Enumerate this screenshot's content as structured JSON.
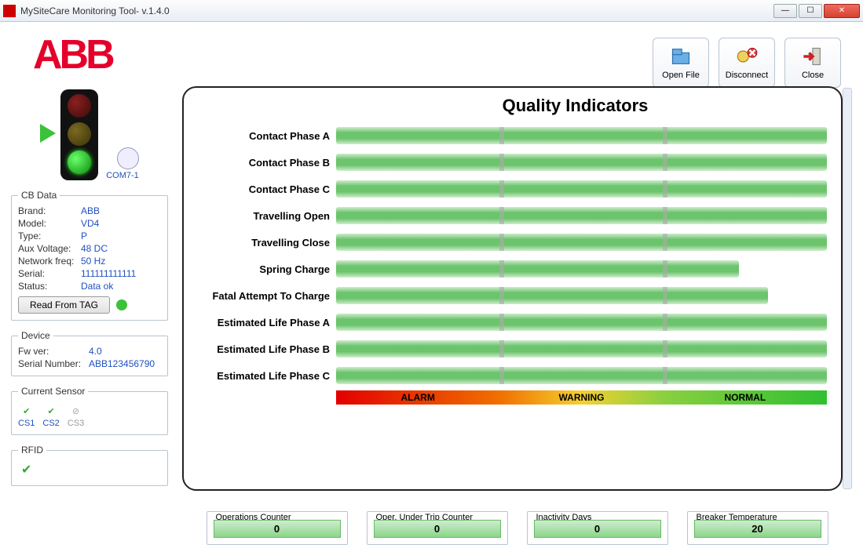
{
  "window": {
    "title": "MySiteCare Monitoring Tool- v.1.4.0"
  },
  "toolbar": {
    "open_file": "Open File",
    "disconnect": "Disconnect",
    "close": "Close"
  },
  "connection": {
    "com_label": "COM7-1"
  },
  "cb_data": {
    "legend": "CB Data",
    "fields": {
      "brand_k": "Brand:",
      "brand_v": "ABB",
      "model_k": "Model:",
      "model_v": "VD4",
      "type_k": "Type:",
      "type_v": "P",
      "aux_k": "Aux Voltage:",
      "aux_v": "48   DC",
      "freq_k": "Network freq:",
      "freq_v": "50 Hz",
      "serial_k": "Serial:",
      "serial_v": "111111111111",
      "status_k": "Status:",
      "status_v": "Data ok"
    },
    "read_tag": "Read From TAG"
  },
  "device": {
    "legend": "Device",
    "fw_k": "Fw ver:",
    "fw_v": "4.0",
    "sn_k": "Serial Number:",
    "sn_v": "ABB123456790"
  },
  "sensors": {
    "legend": "Current Sensor",
    "cs1": "CS1",
    "cs2": "CS2",
    "cs3": "CS3"
  },
  "rfid": {
    "legend": "RFID"
  },
  "panel": {
    "title": "Quality Indicators",
    "indicators": [
      {
        "label": "Contact Phase A",
        "pct": 100
      },
      {
        "label": "Contact Phase B",
        "pct": 100
      },
      {
        "label": "Contact Phase C",
        "pct": 100
      },
      {
        "label": "Travelling Open",
        "pct": 100
      },
      {
        "label": "Travelling Close",
        "pct": 100
      },
      {
        "label": "Spring Charge",
        "pct": 82
      },
      {
        "label": "Fatal Attempt To Charge",
        "pct": 88
      },
      {
        "label": "Estimated Life Phase A",
        "pct": 100
      },
      {
        "label": "Estimated Life Phase B",
        "pct": 100
      },
      {
        "label": "Estimated Life Phase C",
        "pct": 100
      }
    ],
    "zones": {
      "alarm": "ALARM",
      "warning": "WARNING",
      "normal": "NORMAL"
    }
  },
  "counters": {
    "ops": {
      "label": "Operations Counter",
      "value": "0"
    },
    "trip": {
      "label": "Oper. Under Trip Counter",
      "value": "0"
    },
    "inact": {
      "label": "Inactivity Days",
      "value": "0"
    },
    "temp": {
      "label": "Breaker Temperature",
      "value": "20"
    }
  },
  "chart_data": {
    "type": "bar",
    "title": "Quality Indicators",
    "categories": [
      "Contact Phase A",
      "Contact Phase B",
      "Contact Phase C",
      "Travelling Open",
      "Travelling Close",
      "Spring Charge",
      "Fatal Attempt To Charge",
      "Estimated Life Phase A",
      "Estimated Life Phase B",
      "Estimated Life Phase C"
    ],
    "values": [
      100,
      100,
      100,
      100,
      100,
      82,
      88,
      100,
      100,
      100
    ],
    "zones": [
      {
        "name": "ALARM",
        "range": [
          0,
          33
        ]
      },
      {
        "name": "WARNING",
        "range": [
          33,
          66
        ]
      },
      {
        "name": "NORMAL",
        "range": [
          66,
          100
        ]
      }
    ],
    "ylim": [
      0,
      100
    ]
  }
}
